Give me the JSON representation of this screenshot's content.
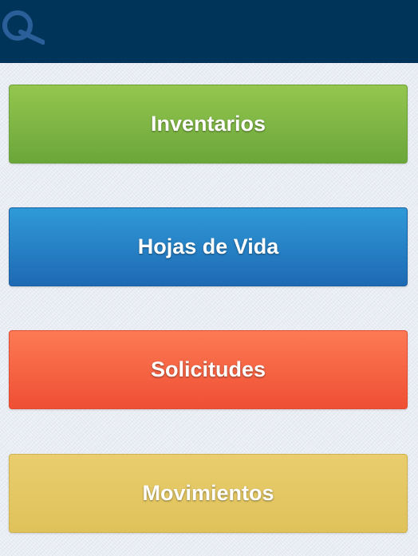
{
  "header": {
    "logo_icon": "q-logo-icon",
    "background_color": "#003459"
  },
  "menu": {
    "items": [
      {
        "label": "Inventarios",
        "color": "#7fb545"
      },
      {
        "label": "Hojas de Vida",
        "color": "#2680c5"
      },
      {
        "label": "Solicitudes",
        "color": "#f56545"
      },
      {
        "label": "Movimientos",
        "color": "#e4c864"
      }
    ]
  }
}
